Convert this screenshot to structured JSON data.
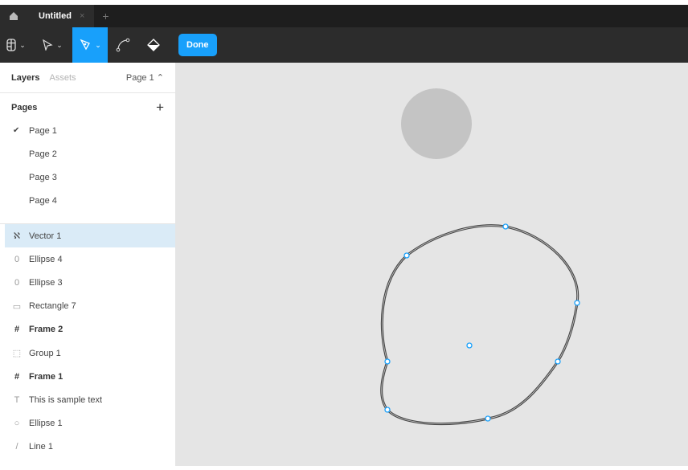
{
  "tabbar": {
    "tab_title": "Untitled",
    "close": "×",
    "new_tab": "+"
  },
  "toolbar": {
    "done_label": "Done"
  },
  "sidebar": {
    "tabs": {
      "layers": "Layers",
      "assets": "Assets",
      "page_selector": "Page 1 ⌃"
    },
    "pages_title": "Pages",
    "add": "+",
    "pages": [
      {
        "label": "Page 1",
        "check": "✔"
      },
      {
        "label": "Page 2"
      },
      {
        "label": "Page 3"
      },
      {
        "label": "Page 4"
      }
    ],
    "layers": [
      {
        "label": "Vector 1",
        "icon": "vector-icon",
        "glyph": "ℵ"
      },
      {
        "label": "Ellipse 4",
        "icon": "ellipse-icon",
        "glyph": "0"
      },
      {
        "label": "Ellipse 3",
        "icon": "ellipse-icon",
        "glyph": "0"
      },
      {
        "label": "Rectangle 7",
        "icon": "rectangle-icon",
        "glyph": "▭"
      },
      {
        "label": "Frame 2",
        "icon": "frame-icon",
        "glyph": "#"
      },
      {
        "label": "Group 1",
        "icon": "group-icon",
        "glyph": "⬚"
      },
      {
        "label": "Frame 1",
        "icon": "frame-icon",
        "glyph": "#"
      },
      {
        "label": "This is sample text",
        "icon": "text-icon",
        "glyph": "T"
      },
      {
        "label": "Ellipse 1",
        "icon": "ellipse-icon",
        "glyph": "○"
      },
      {
        "label": "Line 1",
        "icon": "line-icon",
        "glyph": "/"
      }
    ]
  },
  "colors": {
    "accent": "#18a0fb",
    "canvas": "#e5e5e5"
  }
}
